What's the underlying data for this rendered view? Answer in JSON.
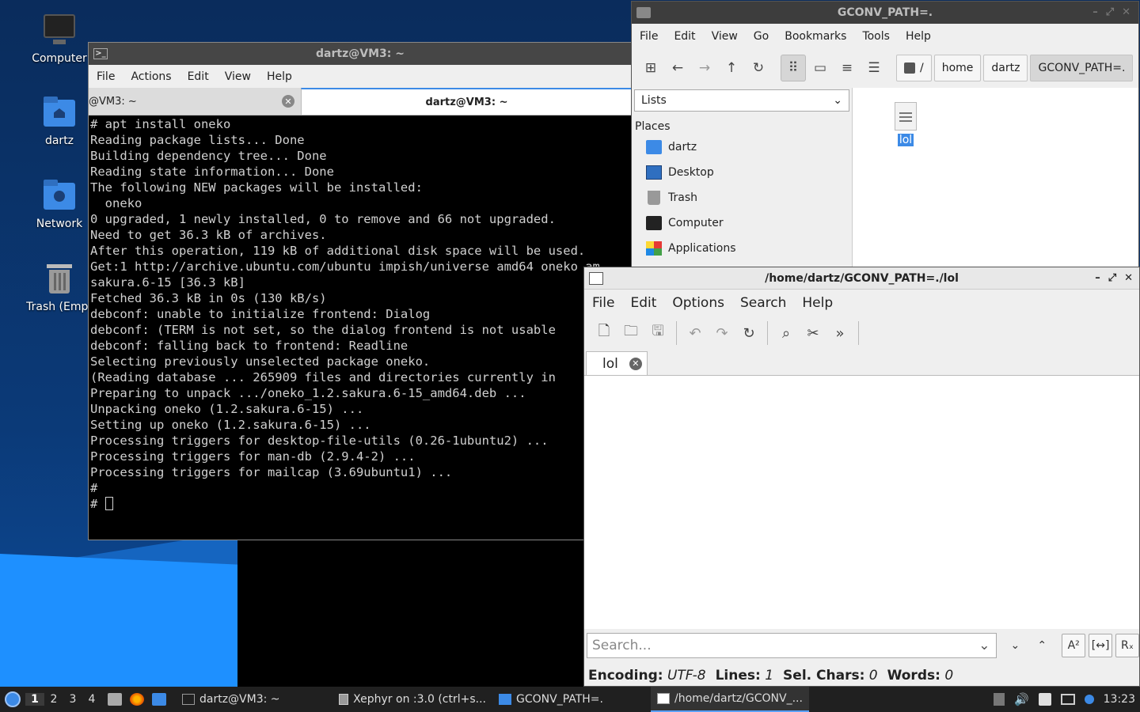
{
  "desktop": {
    "icons": [
      {
        "label": "Computer"
      },
      {
        "label": "dartz"
      },
      {
        "label": "Network"
      },
      {
        "label": "Trash (Empt"
      }
    ]
  },
  "terminal": {
    "title": "dartz@VM3: ~",
    "menu": [
      "File",
      "Actions",
      "Edit",
      "View",
      "Help"
    ],
    "tabs": [
      {
        "label": "@VM3: ~"
      },
      {
        "label": "dartz@VM3: ~"
      }
    ],
    "output": "# apt install oneko\nReading package lists... Done\nBuilding dependency tree... Done\nReading state information... Done\nThe following NEW packages will be installed:\n  oneko\n0 upgraded, 1 newly installed, 0 to remove and 66 not upgraded.\nNeed to get 36.3 kB of archives.\nAfter this operation, 119 kB of additional disk space will be used.\nGet:1 http://archive.ubuntu.com/ubuntu impish/universe amd64 oneko am\nsakura.6-15 [36.3 kB]\nFetched 36.3 kB in 0s (130 kB/s)\ndebconf: unable to initialize frontend: Dialog\ndebconf: (TERM is not set, so the dialog frontend is not usable\ndebconf: falling back to frontend: Readline\nSelecting previously unselected package oneko.\n(Reading database ... 265909 files and directories currently in\nPreparing to unpack .../oneko_1.2.sakura.6-15_amd64.deb ...\nUnpacking oneko (1.2.sakura.6-15) ...\nSetting up oneko (1.2.sakura.6-15) ...\nProcessing triggers for desktop-file-utils (0.26-1ubuntu2) ...\nProcessing triggers for man-db (2.9.4-2) ...\nProcessing triggers for mailcap (3.69ubuntu1) ...\n#",
    "prompt": "# "
  },
  "file_manager": {
    "title": "GCONV_PATH=.",
    "menu": [
      "File",
      "Edit",
      "View",
      "Go",
      "Bookmarks",
      "Tools",
      "Help"
    ],
    "breadcrumb": [
      "/",
      "home",
      "dartz",
      "GCONV_PATH=."
    ],
    "side_combo": "Lists",
    "places_header": "Places",
    "places": [
      "dartz",
      "Desktop",
      "Trash",
      "Computer",
      "Applications"
    ],
    "files": [
      {
        "name": "lol"
      }
    ]
  },
  "editor": {
    "title": "/home/dartz/GCONV_PATH=./lol",
    "menu": [
      "File",
      "Edit",
      "Options",
      "Search",
      "Help"
    ],
    "tab": "lol",
    "search_placeholder": "Search...",
    "status": {
      "encoding_label": "Encoding:",
      "encoding": "UTF-8",
      "lines_label": "Lines:",
      "lines": "1",
      "sel_label": "Sel. Chars:",
      "sel": "0",
      "words_label": "Words:",
      "words": "0"
    },
    "search_btns": {
      "case": "A²",
      "whole": "[↔]",
      "regex": "Rₓ"
    }
  },
  "taskbar": {
    "workspaces": [
      "1",
      "2",
      "3",
      "4"
    ],
    "tasks": [
      {
        "label": "dartz@VM3: ~"
      },
      {
        "label": "Xephyr on :3.0 (ctrl+s..."
      },
      {
        "label": "GCONV_PATH=."
      },
      {
        "label": "/home/dartz/GCONV_..."
      }
    ],
    "clock": "13:23"
  },
  "colors": {
    "accent": "#3c8ae6",
    "selection": "#3c8ae6"
  }
}
